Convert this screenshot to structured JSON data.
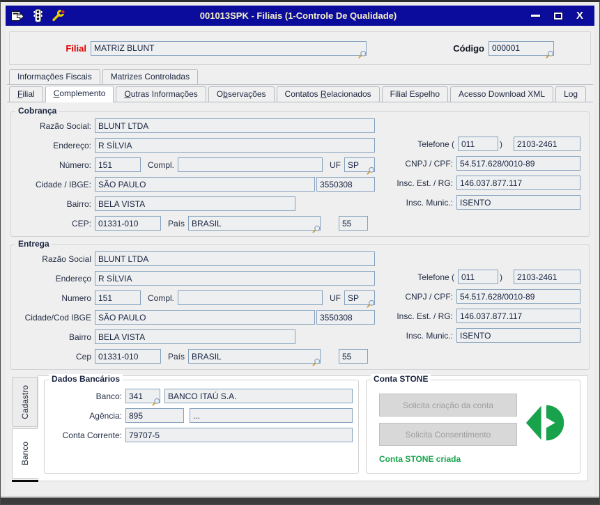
{
  "window": {
    "title": "001013SPK - Filiais (1-Controle De Qualidade)",
    "close_glyph": "X"
  },
  "colors": {
    "titlebar": "#0c0c9c",
    "filial_label_red": "#e00000",
    "stone_green": "#17a24b",
    "input_border": "#84a1bd"
  },
  "header": {
    "filial_label": "Filial",
    "filial_value": "MATRIZ BLUNT",
    "codigo_label": "Código",
    "codigo_value": "000001"
  },
  "tabs_top": [
    {
      "label": "Informações Fiscais"
    },
    {
      "label": "Matrizes Controladas"
    }
  ],
  "tabs_main": [
    {
      "label": "Filial",
      "hotkey": 0
    },
    {
      "label": "Complemento",
      "hotkey": 0,
      "selected": true
    },
    {
      "label": "Outras Informações",
      "hotkey": 0
    },
    {
      "label": "Observações",
      "hotkey": 1
    },
    {
      "label": "Contatos Relacionados",
      "hotkey": 9
    },
    {
      "label": "Filial Espelho",
      "hotkey": -1
    },
    {
      "label": "Acesso Download XML",
      "hotkey": -1
    },
    {
      "label": "Log",
      "hotkey": -1
    }
  ],
  "cobranca": {
    "title": "Cobrança",
    "labels": {
      "razao": "Razão Social:",
      "endereco": "Endereço:",
      "numero": "Número:",
      "compl": "Compl.",
      "uf": "UF",
      "cidade": "Cidade / IBGE:",
      "bairro": "Bairro:",
      "cep": "CEP:",
      "pais": "País",
      "telefone": "Telefone (",
      "telefone_close": ")",
      "cnpj": "CNPJ / CPF:",
      "insc_est": "Insc. Est. / RG:",
      "insc_mun": "Insc. Munic.:"
    },
    "values": {
      "razao": "BLUNT LTDA",
      "endereco": "R SÍLVIA",
      "numero": "151",
      "compl": "",
      "uf": "SP",
      "cidade": "SÃO PAULO",
      "ibge": "3550308",
      "bairro": "BELA VISTA",
      "cep": "01331-010",
      "pais": "BRASIL",
      "pais_cod": "55",
      "ddd": "011",
      "telefone": "2103-2461",
      "cnpj": "54.517.628/0010-89",
      "insc_est": "146.037.877.117",
      "insc_mun": "ISENTO"
    }
  },
  "entrega": {
    "title": "Entrega",
    "labels": {
      "razao": "Razão Social",
      "endereco": "Endereço",
      "numero": "Numero",
      "compl": "Compl.",
      "uf": "UF",
      "cidade": "Cidade/Cod IBGE",
      "bairro": "Bairro",
      "cep": "Cep",
      "pais": "País",
      "telefone": "Telefone (",
      "telefone_close": ")",
      "cnpj": "CNPJ / CPF:",
      "insc_est": "Insc. Est. / RG:",
      "insc_mun": "Insc. Munic.:"
    },
    "values": {
      "razao": "BLUNT LTDA",
      "endereco": "R SÍLVIA",
      "numero": "151",
      "compl": "",
      "uf": "SP",
      "cidade": "SÃO PAULO",
      "ibge": "3550308",
      "bairro": "BELA VISTA",
      "cep": "01331-010",
      "pais": "BRASIL",
      "pais_cod": "55",
      "ddd": "011",
      "telefone": "2103-2461",
      "cnpj": "54.517.628/0010-89",
      "insc_est": "146.037.877.117",
      "insc_mun": "ISENTO"
    }
  },
  "bottom_tabs": [
    {
      "label": "Cadastro"
    },
    {
      "label": "Banco",
      "selected": true
    }
  ],
  "dados_bancarios": {
    "title": "Dados Bancários",
    "banco_label": "Banco:",
    "banco_codigo": "341",
    "banco_nome": "BANCO ITAÚ S.A.",
    "agencia_label": "Agência:",
    "agencia_valor": "895",
    "agencia_extra": "...",
    "conta_label": "Conta Corrente:",
    "conta_valor": "79707-5"
  },
  "conta_stone": {
    "title": "Conta STONE",
    "botao_criacao": "Solicita criação da conta",
    "botao_consentimento": "Solicita Consentimento",
    "status": "Conta STONE criada"
  }
}
